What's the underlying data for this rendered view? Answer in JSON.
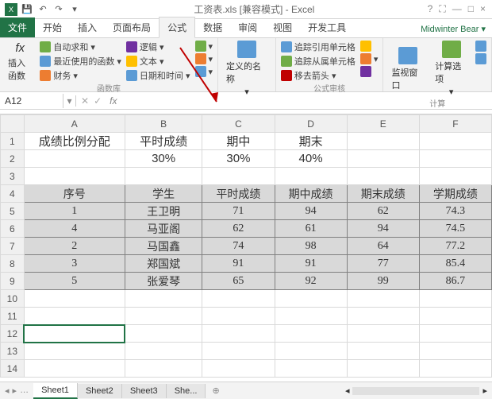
{
  "title": "工资表.xls [兼容模式] - Excel",
  "qat": {
    "save": "💾",
    "undo": "↶",
    "redo": "↷"
  },
  "win": {
    "help": "?",
    "full": "⛶",
    "min": "—",
    "max": "□",
    "close": "×"
  },
  "tabs": {
    "file": "文件",
    "home": "开始",
    "insert": "插入",
    "layout": "页面布局",
    "formulas": "公式",
    "data": "数据",
    "review": "审阅",
    "view": "视图",
    "dev": "开发工具"
  },
  "user": "Midwinter Bear ▾",
  "ribbon": {
    "g1": {
      "big": "插入函数",
      "fx": "fx",
      "c1a": "自动求和 ▾",
      "c1b": "最近使用的函数 ▾",
      "c1c": "财务 ▾",
      "c2a": "逻辑 ▾",
      "c2b": "文本 ▾",
      "c2c": "日期和时间 ▾",
      "name": "函数库"
    },
    "g2": {
      "big": "定义的名称",
      "name": ""
    },
    "g3": {
      "a": "追踪引用单元格",
      "b": "追踪从属单元格",
      "c": "移去箭头 ▾",
      "name": "公式审核"
    },
    "g4": {
      "big1": "监视窗口",
      "big2": "计算选项",
      "name": "计算"
    }
  },
  "namebox": "A12",
  "fx": "fx",
  "formula": "",
  "cols": [
    "A",
    "B",
    "C",
    "D",
    "E",
    "F"
  ],
  "sheet": {
    "r1": {
      "A": "成绩比例分配",
      "B": "平时成绩",
      "C": "期中",
      "D": "期末"
    },
    "r2": {
      "B": "30%",
      "C": "30%",
      "D": "40%"
    },
    "r4": {
      "A": "序号",
      "B": "学生",
      "C": "平时成绩",
      "D": "期中成绩",
      "E": "期末成绩",
      "F": "学期成绩"
    },
    "r5": {
      "A": "1",
      "B": "王卫明",
      "C": "71",
      "D": "94",
      "E": "62",
      "F": "74.3"
    },
    "r6": {
      "A": "4",
      "B": "马亚阁",
      "C": "62",
      "D": "61",
      "E": "94",
      "F": "74.5"
    },
    "r7": {
      "A": "2",
      "B": "马国鑫",
      "C": "74",
      "D": "98",
      "E": "64",
      "F": "77.2"
    },
    "r8": {
      "A": "3",
      "B": "郑国斌",
      "C": "91",
      "D": "91",
      "E": "77",
      "F": "85.4"
    },
    "r9": {
      "A": "5",
      "B": "张爱琴",
      "C": "65",
      "D": "92",
      "E": "99",
      "F": "86.7"
    }
  },
  "rows": [
    "1",
    "2",
    "3",
    "4",
    "5",
    "6",
    "7",
    "8",
    "9",
    "10",
    "11",
    "12",
    "13",
    "14"
  ],
  "sheetTabs": {
    "s1": "Sheet1",
    "s2": "Sheet2",
    "s3": "Sheet3",
    "more": "She..."
  },
  "selectedCell": "A12"
}
